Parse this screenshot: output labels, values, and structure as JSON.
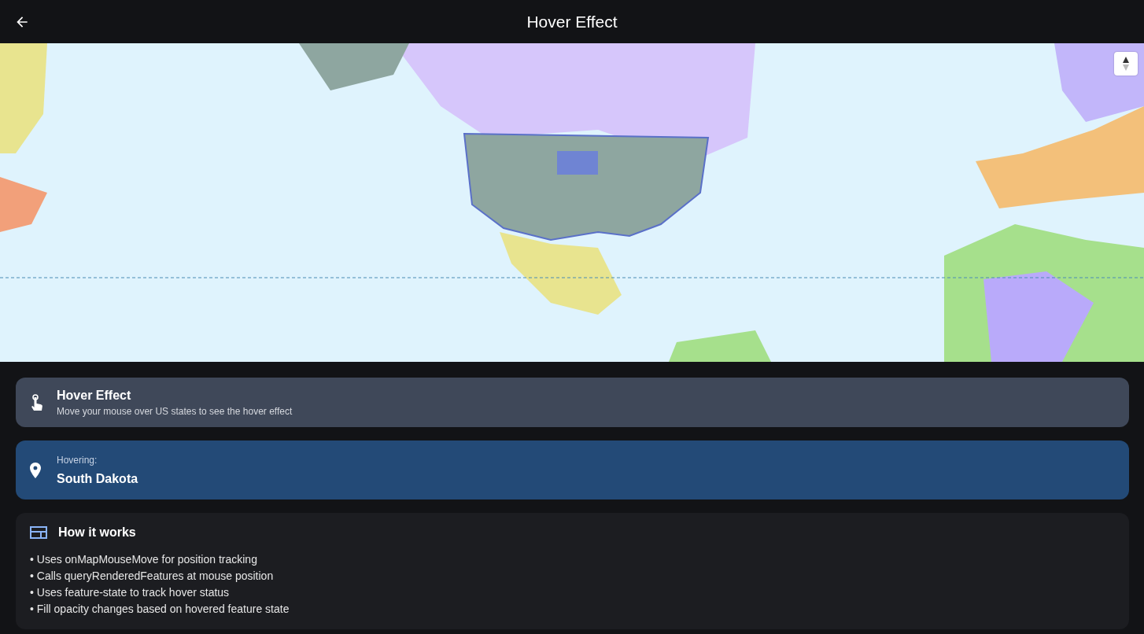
{
  "app_bar": {
    "title": "Hover Effect"
  },
  "info_card": {
    "title": "Hover Effect",
    "subtitle": "Move your mouse over US states to see the hover effect"
  },
  "hover_card": {
    "label": "Hovering:",
    "value": "South Dakota"
  },
  "how_it_works": {
    "title": "How it works",
    "items": [
      "• Uses onMapMouseMove for position tracking",
      "• Calls queryRenderedFeatures at mouse position",
      "• Uses feature-state to track hover status",
      "• Fill opacity changes based on hovered feature state"
    ]
  }
}
